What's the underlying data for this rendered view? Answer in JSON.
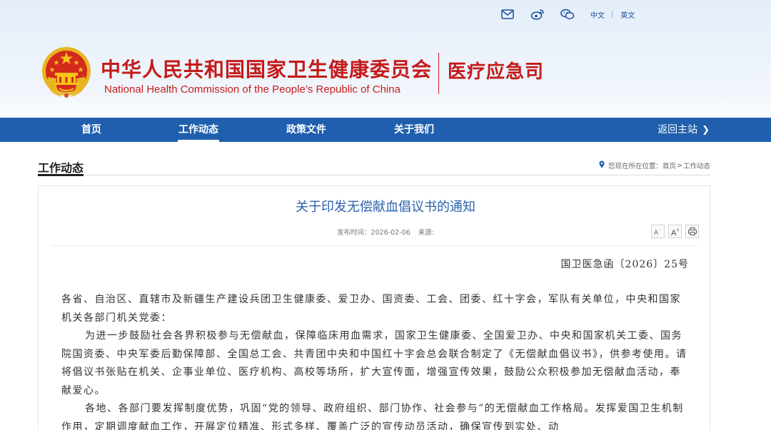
{
  "header": {
    "top_icons": [
      "mail-icon",
      "weibo-icon",
      "wechat-icon"
    ],
    "lang_cn": "中文",
    "lang_separator": "|",
    "lang_en": "英文",
    "title_cn": "中华人民共和国国家卫生健康委员会",
    "title_en": "National Health Commission of the People’s Republic of China",
    "department": "医疗应急司"
  },
  "nav": {
    "items": [
      {
        "label": "首页"
      },
      {
        "label": "工作动态"
      },
      {
        "label": "政策文件"
      },
      {
        "label": "关于我们"
      }
    ],
    "active": "工作动态",
    "back_label": "返回主站"
  },
  "section": {
    "title": "工作动态",
    "breadcrumb_prefix": "您现在所在位置：",
    "breadcrumb_home": "首页",
    "breadcrumb_separator": ">",
    "breadcrumb_current": "工作动态"
  },
  "article": {
    "title": "关于印发无偿献血倡议书的通知",
    "publish_label": "发布时间：",
    "publish_date": "2026-02-06",
    "source_label": "来源:",
    "font_decrease": "A-",
    "font_increase": "A+",
    "print_icon": "print-icon",
    "doc_number": "国卫医急函〔2026〕25号",
    "paragraphs": [
      "各省、自治区、直辖市及新疆生产建设兵团卫生健康委、爱卫办、国资委、工会、团委、红十字会，军队有关单位，中央和国家机关各部门机关党委：",
      "为进一步鼓励社会各界积极参与无偿献血，保障临床用血需求，国家卫生健康委、全国爱卫办、中央和国家机关工委、国务院国资委、中央军委后勤保障部、全国总工会、共青团中央和中国红十字会总会联合制定了《无偿献血倡议书》，供参考使用。请将倡议书张贴在机关、企事业单位、医疗机构、高校等场所，扩大宣传面，增强宣传效果，鼓励公众积极参加无偿献血活动，奉献爱心。",
      "各地、各部门要发挥制度优势，巩固“党的领导、政府组织、部门协作、社会参与”的无偿献血工作格局。发挥爱国卫生机制作用，定期调度献血工作，开展定位精准、形式多样、覆盖广泛的宣传动员活动，确保宣传到实处、动"
    ]
  },
  "colors": {
    "brand_red": "#c41a1a",
    "nav_blue": "#1f5fae",
    "title_blue": "#2b62ad"
  }
}
